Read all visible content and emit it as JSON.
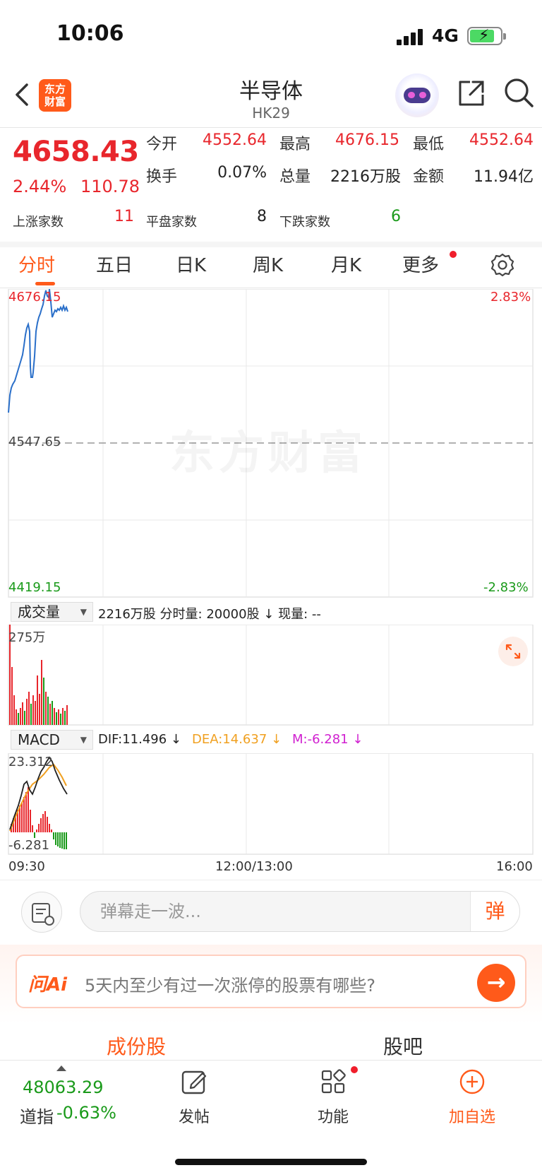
{
  "status_bar": {
    "time": "10:06",
    "network": "4G"
  },
  "nav": {
    "brand_line1": "东方",
    "brand_line2": "财富",
    "title": "半导体",
    "subtitle": "HK29"
  },
  "quote": {
    "price": "4658.43",
    "change_pct": "2.44%",
    "change": "110.78",
    "open_label": "今开",
    "open": "4552.64",
    "high_label": "最高",
    "high": "4676.15",
    "low_label": "最低",
    "low": "4552.64",
    "turnover_label": "换手",
    "turnover": "0.07%",
    "volume_label": "总量",
    "volume": "2216万股",
    "amount_label": "金额",
    "amount": "11.94亿",
    "up_label": "上涨家数",
    "up_count": "11",
    "flat_label": "平盘家数",
    "flat_count": "8",
    "down_label": "下跌家数",
    "down_count": "6"
  },
  "tabs": [
    {
      "label": "分时"
    },
    {
      "label": "五日"
    },
    {
      "label": "日K"
    },
    {
      "label": "周K"
    },
    {
      "label": "月K"
    },
    {
      "label": "更多"
    }
  ],
  "chart": {
    "high_label": "4676.15",
    "mid_label": "4547.65",
    "low_label": "4419.15",
    "high_pct": "2.83%",
    "low_pct": "-2.83%",
    "watermark": "东方财富"
  },
  "volume_panel": {
    "selector": "成交量",
    "summary": "2216万股 分时量: 20000股 ↓ 现量: --",
    "max_label": "275万"
  },
  "macd_panel": {
    "selector": "MACD",
    "dif": "DIF:11.496 ↓",
    "dea": "DEA:14.637 ↓",
    "m": "M:-6.281 ↓",
    "max_label": "23.312",
    "min_label": "-6.281"
  },
  "time_axis": {
    "start": "09:30",
    "mid": "12:00/13:00",
    "end": "16:00"
  },
  "comment": {
    "placeholder": "弹幕走一波...",
    "danmu_label": "弹"
  },
  "ai": {
    "logo": "问Ai",
    "question": "5天内至少有过一次涨停的股票有哪些?"
  },
  "sub_tabs": {
    "left": "成份股",
    "right": "股吧"
  },
  "bottom": {
    "index_value": "48063.29",
    "index_name": "道指",
    "index_pct": "-0.63%",
    "post_label": "发帖",
    "feature_label": "功能",
    "add_label": "加自选"
  },
  "colors": {
    "up": "#e8262c",
    "down": "#1a9a1a",
    "accent": "#ff5a1a",
    "line": "#2a6fc9",
    "dea": "#f0a020",
    "m": "#d020d0"
  }
}
